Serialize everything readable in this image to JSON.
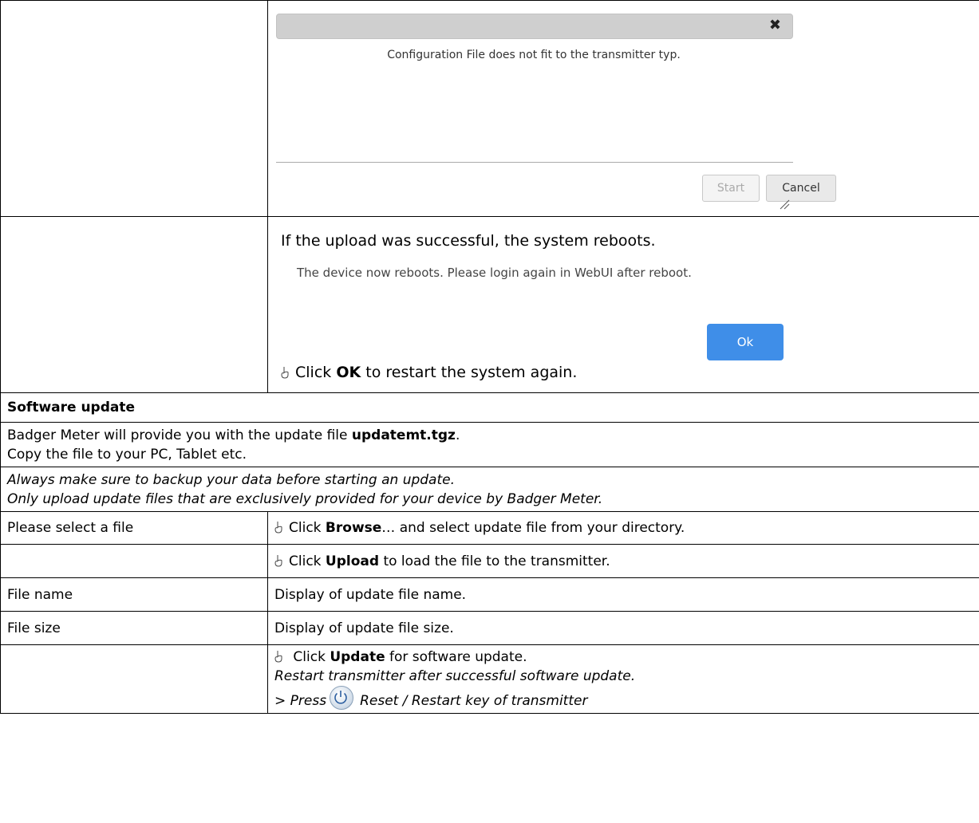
{
  "dialog": {
    "close_glyph": "✖",
    "message": "Configuration File does not fit to the transmitter typ.",
    "start_label": "Start",
    "cancel_label": "Cancel"
  },
  "reboot": {
    "intro": "If the upload was successful, the system reboots.",
    "message": "The device now reboots. Please login again in WebUI after reboot.",
    "ok_label": "Ok",
    "instr_pre": "Click ",
    "instr_bold": "OK",
    "instr_post": " to restart the system again."
  },
  "software_update": {
    "title": "Software update",
    "line1_pre": "Badger Meter will provide you with the update file ",
    "line1_bold": "updatemt.tgz",
    "line1_post": ".",
    "line2": "Copy the file to your PC, Tablet etc.",
    "note1": "Always make sure to backup your data before starting an update.",
    "note2": "Only upload update files that are exclusively provided for your device by Badger Meter.",
    "rows": [
      {
        "label": "Please select a file",
        "pre": "Click ",
        "bold": "Browse",
        "post": "… and select update file from your directory."
      },
      {
        "label": "",
        "pre": "Click ",
        "bold": "Upload",
        "post": " to load the file to the transmitter."
      },
      {
        "label": "File name",
        "text": "Display of update file name."
      },
      {
        "label": "File size",
        "text": "Display of update file size."
      }
    ],
    "final": {
      "pre": " Click ",
      "bold": "Update",
      "post": " for software update.",
      "note": "Restart transmitter after successful software update.",
      "press_pre": "> Press",
      "press_post": "Reset / Restart key of transmitter"
    }
  }
}
